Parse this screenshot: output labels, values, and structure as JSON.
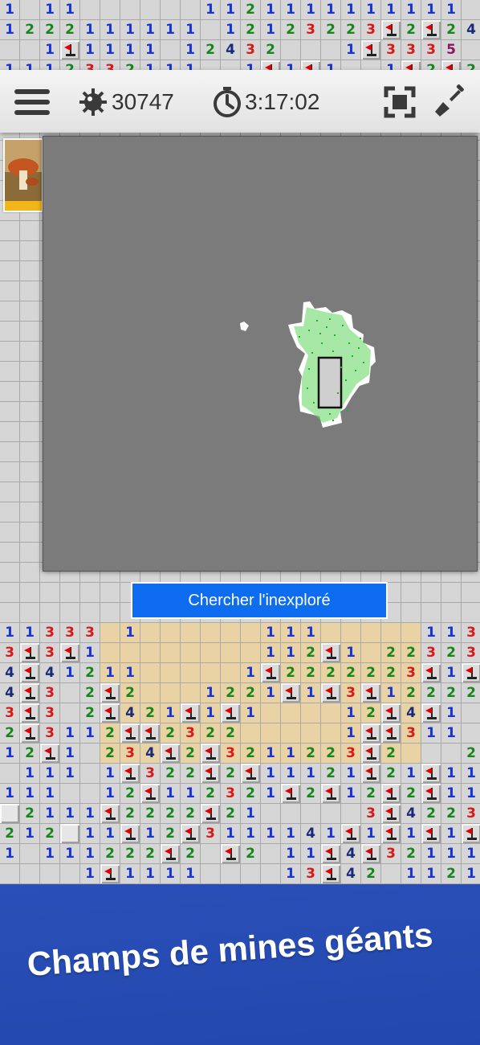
{
  "toolbar": {
    "menu_icon": "hamburger-menu-icon",
    "mine_icon": "mine-icon",
    "mine_count": "30747",
    "timer_icon": "stopwatch-icon",
    "timer": "3:17:02",
    "fullscreen_icon": "fullscreen-frame-icon",
    "shovel_icon": "shovel-icon"
  },
  "minimap": {
    "search_label": "Chercher l'inexploré"
  },
  "banner": {
    "title": "Champs de mines géants"
  },
  "colors": {
    "toolbar_bg": "#ececec",
    "minimap_bg": "#7b7b7b",
    "search_button": "#0d6cf0",
    "banner_blue": "#2a4fb8",
    "banner_gold": "#f3c53a",
    "explored_green": "#2ecc40",
    "n1": "#1833d6",
    "n2": "#15861c",
    "n3": "#d91818",
    "n4": "#1a2a7a"
  },
  "board_rows": [
    "1.11......1121111111111",
    "1222111111.12123223F2F24",
    "..1F1111.12432...1F3335",
    "1112332111..1F1F1..1F2F2",
    "........................",
    "........................",
    "........................",
    "........................",
    "........................",
    "........................",
    "........................",
    "........................",
    "........................",
    "........................",
    "........................",
    "........................",
    "........................",
    "........................",
    "........................",
    "........................",
    "........................",
    "........................",
    "........................",
    "........................",
    "........................",
    "........................",
    "........................",
    "........................",
    "........................",
    "........................",
    "........................",
    "11333 1......111.....1131F",
    "3F3F1........112F1.223233",
    "4F41211.....1F2222223F1F2",
    "4F3.2F2...1221F1F3F12222",
    "3F3.2F421F1F1....12F4F1..",
    "2F3112FF2322.....1FF311.1",
    "12F1.234F2F3211223F2...2",
    ".111.1F322F2F11121F21F11",
    "111..12F112321F2F12F2F11",
    "#2111F2222F21.....3F42233",
    "212#11F12F3111141F1F1F1F",
    "1.111222F2.F2.11F4F3211122",
    "....1F1111....13F42.1121",
    ".1112F2......F..F......."
  ]
}
